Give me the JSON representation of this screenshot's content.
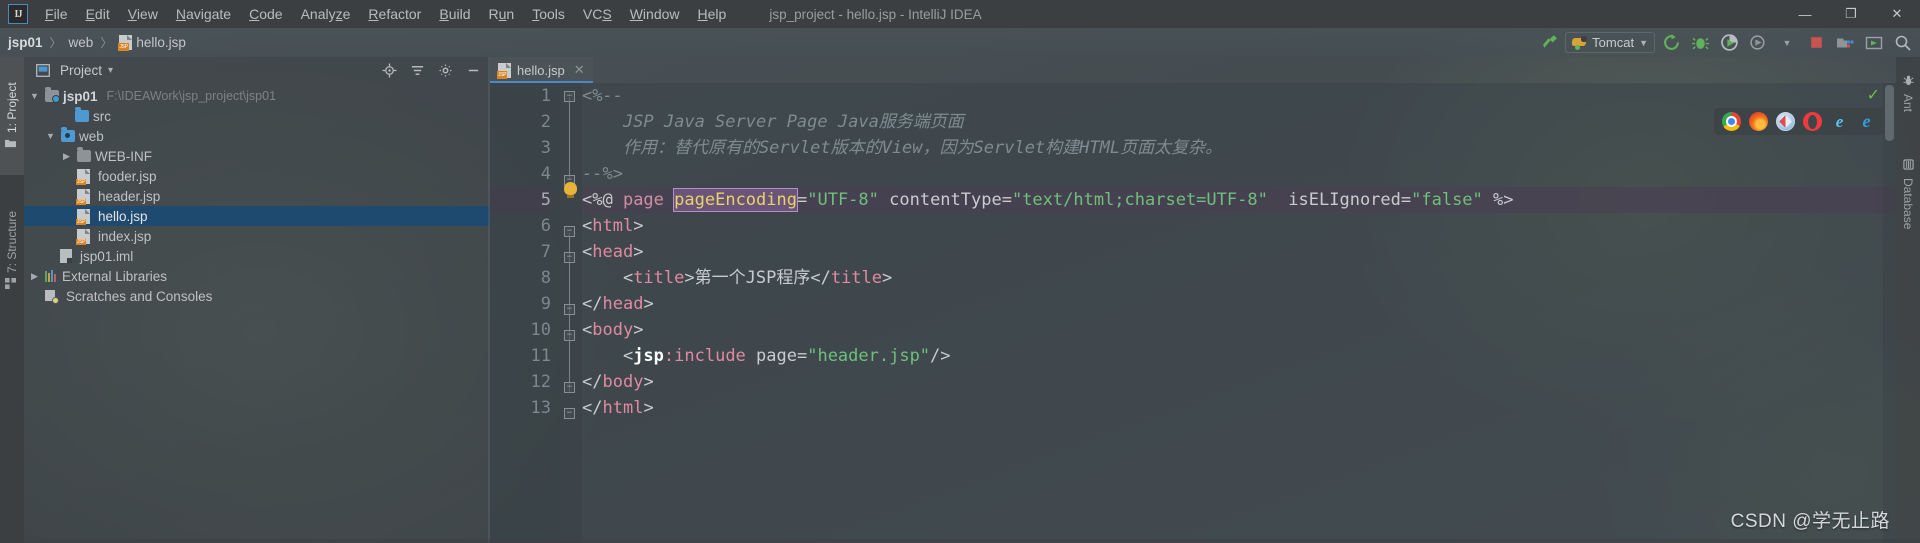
{
  "window": {
    "title": "jsp_project - hello.jsp - IntelliJ IDEA",
    "logo": "IJ",
    "minimize": "—",
    "maximize": "❐",
    "close": "✕"
  },
  "menubar": {
    "items": [
      {
        "label": "File",
        "mnemonic": "F"
      },
      {
        "label": "Edit",
        "mnemonic": "E"
      },
      {
        "label": "View",
        "mnemonic": "V"
      },
      {
        "label": "Navigate",
        "mnemonic": "N"
      },
      {
        "label": "Code",
        "mnemonic": "C"
      },
      {
        "label": "Analyze",
        "mnemonic": "z"
      },
      {
        "label": "Refactor",
        "mnemonic": "R"
      },
      {
        "label": "Build",
        "mnemonic": "B"
      },
      {
        "label": "Run",
        "mnemonic": "u"
      },
      {
        "label": "Tools",
        "mnemonic": "T"
      },
      {
        "label": "VCS",
        "mnemonic": "S"
      },
      {
        "label": "Window",
        "mnemonic": "W"
      },
      {
        "label": "Help",
        "mnemonic": "H"
      }
    ]
  },
  "breadcrumb": {
    "project": "jsp01",
    "folder": "web",
    "file": "hello.jsp",
    "separator": "〉"
  },
  "toolbar": {
    "run_config": "Tomcat",
    "icons": [
      "hammer-build-icon",
      "rerun-icon",
      "debug-bug-icon",
      "run-with-coverage-icon",
      "profile-icon",
      "stop-icon",
      "project-structure-icon",
      "update-app-icon",
      "search-everywhere-icon"
    ]
  },
  "left_tool_tabs": [
    {
      "label": "1: Project",
      "mnemonic": "1",
      "icon": "project-folder-icon",
      "active": true
    },
    {
      "label": "7: Structure",
      "mnemonic": "7",
      "icon": "structure-icon",
      "active": false
    }
  ],
  "right_tool_tabs": [
    {
      "label": "Ant",
      "icon": "ant-bug-icon"
    },
    {
      "label": "Database",
      "icon": "database-icon"
    }
  ],
  "project_panel": {
    "title": "Project",
    "dropdown": "▾",
    "header_icons": [
      "locate-target-icon",
      "collapse-all-icon",
      "gear-icon",
      "hide-minimize-icon"
    ],
    "tree": [
      {
        "label": "jsp01",
        "path": "F:\\IDEAWork\\jsp_project\\jsp01",
        "indent": 0,
        "arrow": "▼",
        "icon": "module-folder-icon",
        "bold": true,
        "selected": false
      },
      {
        "label": "src",
        "path": "",
        "indent": 1,
        "arrow": "",
        "icon": "source-folder-icon",
        "bold": false,
        "selected": false
      },
      {
        "label": "web",
        "path": "",
        "indent": 1,
        "arrow": "▼",
        "icon": "web-folder-icon",
        "bold": false,
        "selected": false
      },
      {
        "label": "WEB-INF",
        "path": "",
        "indent": 2,
        "arrow": "▶",
        "icon": "folder-icon",
        "bold": false,
        "selected": false
      },
      {
        "label": "fooder.jsp",
        "path": "",
        "indent": 2,
        "arrow": "",
        "icon": "jsp-file-icon",
        "bold": false,
        "selected": false
      },
      {
        "label": "header.jsp",
        "path": "",
        "indent": 2,
        "arrow": "",
        "icon": "jsp-file-icon",
        "bold": false,
        "selected": false
      },
      {
        "label": "hello.jsp",
        "path": "",
        "indent": 2,
        "arrow": "",
        "icon": "jsp-file-icon",
        "bold": false,
        "selected": true
      },
      {
        "label": "index.jsp",
        "path": "",
        "indent": 2,
        "arrow": "",
        "icon": "jsp-file-icon",
        "bold": false,
        "selected": false
      },
      {
        "label": "jsp01.iml",
        "path": "",
        "indent": 1,
        "arrow": "",
        "icon": "iml-file-icon",
        "bold": false,
        "selected": false
      },
      {
        "label": "External Libraries",
        "path": "",
        "indent": 0,
        "arrow": "▶",
        "icon": "libraries-icon",
        "bold": false,
        "selected": false
      },
      {
        "label": "Scratches and Consoles",
        "path": "",
        "indent": 0,
        "arrow": "",
        "icon": "scratches-icon",
        "bold": false,
        "selected": false
      }
    ]
  },
  "editor": {
    "tab": {
      "label": "hello.jsp",
      "icon": "jsp-file-icon",
      "close": "✕"
    },
    "current_line": 5,
    "line_numbers": [
      1,
      2,
      3,
      4,
      5,
      6,
      7,
      8,
      9,
      10,
      11,
      12,
      13
    ],
    "lines": [
      {
        "n": 1,
        "raw": "<%--"
      },
      {
        "n": 2,
        "raw": "    JSP Java Server Page Java服务端页面"
      },
      {
        "n": 3,
        "raw": "    作用：替代原有的Servlet版本的View，因为Servlet构建HTML页面太复杂。"
      },
      {
        "n": 4,
        "raw": "--%>"
      },
      {
        "n": 5,
        "raw": "<%@ page pageEncoding=\"UTF-8\" contentType=\"text/html;charset=UTF-8\"  isELIgnored=\"false\" %>"
      },
      {
        "n": 6,
        "raw": "<html>"
      },
      {
        "n": 7,
        "raw": "<head>"
      },
      {
        "n": 8,
        "raw": "    <title>第一个JSP程序</title>"
      },
      {
        "n": 9,
        "raw": "</head>"
      },
      {
        "n": 10,
        "raw": "<body>"
      },
      {
        "n": 11,
        "raw": "    <jsp:include page=\"header.jsp\"/>"
      },
      {
        "n": 12,
        "raw": "</body>"
      },
      {
        "n": 13,
        "raw": "</html>"
      }
    ],
    "highlighted_token": "pageEncoding",
    "inspection_status": "ok"
  },
  "browser_popup": {
    "browsers": [
      "chrome-icon",
      "firefox-icon",
      "safari-icon",
      "opera-icon",
      "internet-explorer-icon",
      "edge-icon"
    ]
  },
  "watermark": "CSDN @学无止路",
  "colors": {
    "accent": "#4a88c7",
    "selection": "#1f4a70",
    "string": "#6ec07a",
    "tag": "#e08aa0",
    "attr_highlight": "#e8d36a",
    "comment": "#7d8b92",
    "run_green": "#6bbf4e",
    "stop_red": "#c75450",
    "jsp_badge": "#d98324"
  }
}
